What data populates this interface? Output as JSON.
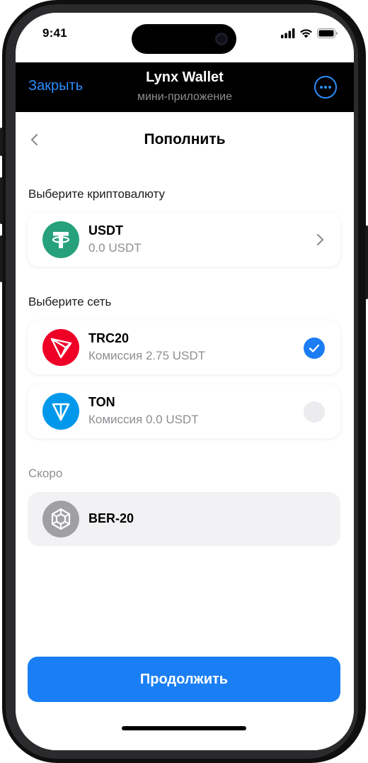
{
  "status_bar": {
    "time": "9:41"
  },
  "header": {
    "close_label": "Закрыть",
    "title": "Lynx Wallet",
    "subtitle": "мини-приложение",
    "menu_icon": "ellipsis-circle-icon"
  },
  "page": {
    "title": "Пополнить",
    "back_icon": "chevron-left-icon"
  },
  "crypto_section": {
    "label": "Выберите криптовалюту",
    "selected": {
      "name": "USDT",
      "balance": "0.0 USDT",
      "icon": "tether-icon",
      "color": "#26a17b"
    }
  },
  "network_section": {
    "label": "Выберите сеть",
    "options": [
      {
        "name": "TRC20",
        "fee": "Комиссия 2.75 USDT",
        "icon": "tron-icon",
        "color": "#ef0027",
        "selected": true
      },
      {
        "name": "TON",
        "fee": "Комиссия 0.0 USDT",
        "icon": "ton-icon",
        "color": "#0098ea",
        "selected": false
      }
    ]
  },
  "soon_section": {
    "label": "Скоро",
    "options": [
      {
        "name": "BER-20",
        "icon": "bnb-icon",
        "color": "#a0a0a4"
      }
    ]
  },
  "continue_label": "Продолжить",
  "colors": {
    "accent": "#1a7ff5",
    "link": "#2a8cff"
  }
}
